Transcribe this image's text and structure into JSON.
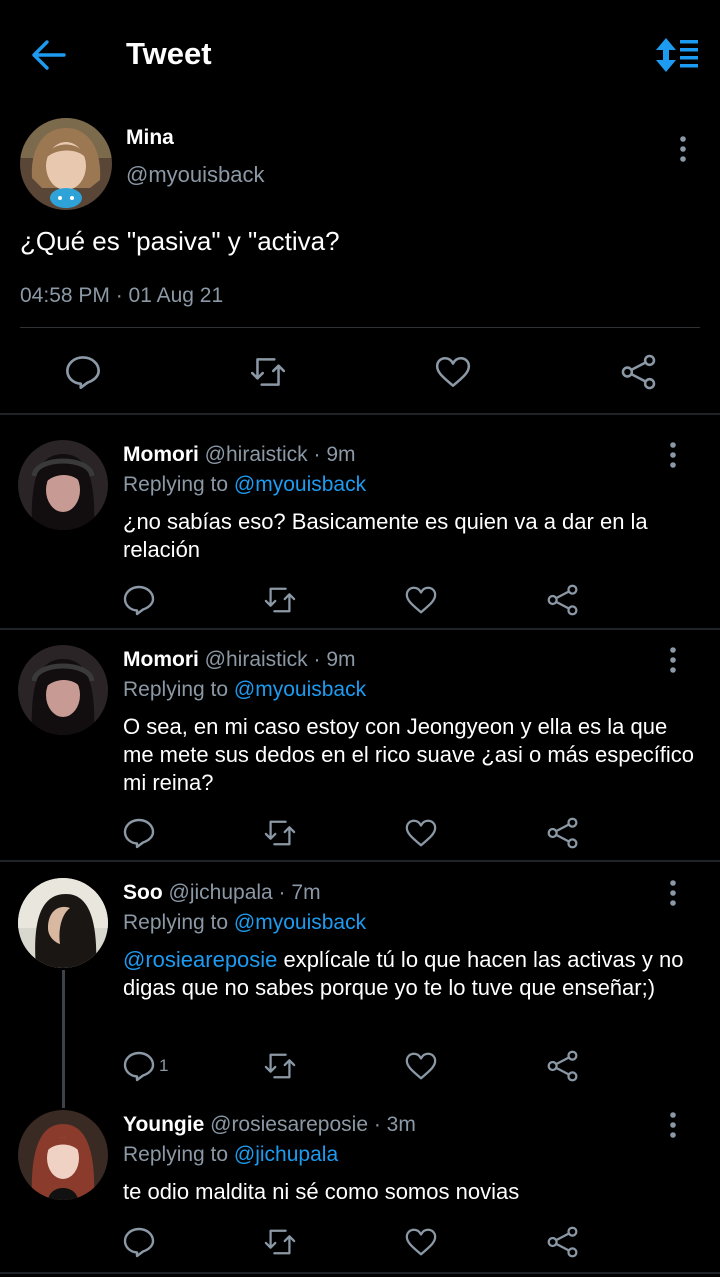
{
  "header": {
    "title": "Tweet",
    "back_icon": "arrow-left-icon",
    "sort_icon": "sort-icon",
    "accent": "#1d9bf0"
  },
  "tweet": {
    "name": "Mina",
    "handle": "@myouisback",
    "text": "¿Qué es \"pasiva\" y \"activa?",
    "timestamp": "04:58 PM · 01 Aug 21",
    "actions": [
      "reply-icon",
      "retweet-icon",
      "like-icon",
      "share-icon"
    ]
  },
  "replies": [
    {
      "name": "Momori",
      "handle_time": "@hiraistick · 9m",
      "replying_label": "Replying to",
      "replying_to": "@myouisback",
      "mention": "",
      "text": "¿no sabías eso? Basicamente es quien va a dar en la relación",
      "reply_count": ""
    },
    {
      "name": "Momori",
      "handle_time": "@hiraistick · 9m",
      "replying_label": "Replying to",
      "replying_to": "@myouisback",
      "mention": "",
      "text": "O sea, en mi caso estoy con Jeongyeon y ella es la que me mete sus dedos en el rico suave ¿asi o más específico mi reina?",
      "reply_count": ""
    },
    {
      "name": "Soo",
      "handle_time": "@jichupala · 7m",
      "replying_label": "Replying to",
      "replying_to": "@myouisback",
      "mention": "@rosieareposie",
      "text": " explícale tú lo que hacen las activas y no digas que no sabes porque yo te lo tuve que enseñar;)",
      "reply_count": "1"
    },
    {
      "name": "Youngie",
      "handle_time": "@rosiesareposie · 3m",
      "replying_label": "Replying to",
      "replying_to": "@jichupala",
      "mention": "",
      "text": "te odio maldita ni sé como somos novias",
      "reply_count": ""
    }
  ]
}
